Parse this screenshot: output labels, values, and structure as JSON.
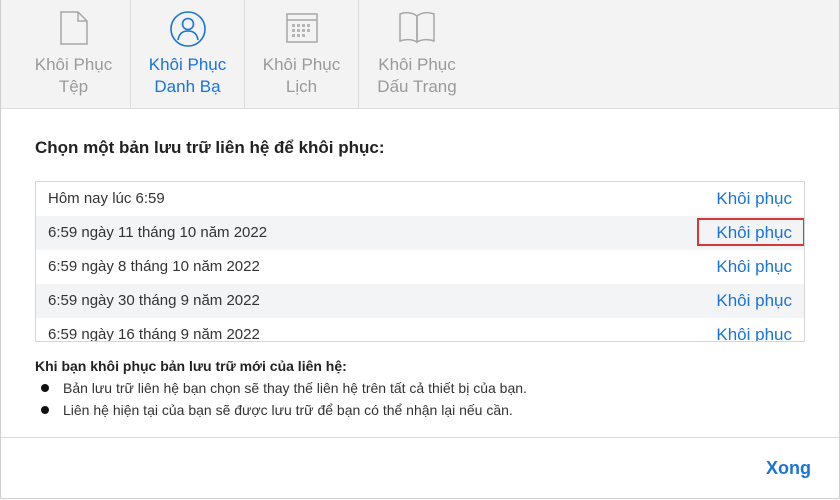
{
  "tabs": [
    {
      "line1": "Khôi Phục",
      "line2": "Tệp",
      "icon": "file-icon",
      "active": false
    },
    {
      "line1": "Khôi Phục",
      "line2": "Danh Bạ",
      "icon": "contacts-icon",
      "active": true
    },
    {
      "line1": "Khôi Phục",
      "line2": "Lịch",
      "icon": "calendar-icon",
      "active": false
    },
    {
      "line1": "Khôi Phục",
      "line2": "Dấu Trang",
      "icon": "bookmarks-icon",
      "active": false
    }
  ],
  "heading": "Chọn một bản lưu trữ liên hệ để khôi phục:",
  "archives": [
    {
      "date": "Hôm nay lúc 6:59",
      "action": "Khôi phục"
    },
    {
      "date": "6:59 ngày 11 tháng 10 năm 2022",
      "action": "Khôi phục"
    },
    {
      "date": "6:59 ngày 8 tháng 10 năm 2022",
      "action": "Khôi phục"
    },
    {
      "date": "6:59 ngày 30 tháng 9 năm 2022",
      "action": "Khôi phục"
    },
    {
      "date": "6:59 ngày 16 tháng 9 năm 2022",
      "action": "Khôi phục"
    }
  ],
  "info": {
    "title": "Khi bạn khôi phục bản lưu trữ mới của liên hệ:",
    "bullets": [
      "Bản lưu trữ liên hệ bạn chọn sẽ thay thế liên hệ trên tất cả thiết bị của bạn.",
      "Liên hệ hiện tại của bạn sẽ được lưu trữ để bạn có thể nhận lại nếu cần."
    ]
  },
  "done_label": "Xong",
  "colors": {
    "accent": "#1a73d9",
    "highlight": "#d9363a",
    "inactive": "#9a9a9a"
  }
}
